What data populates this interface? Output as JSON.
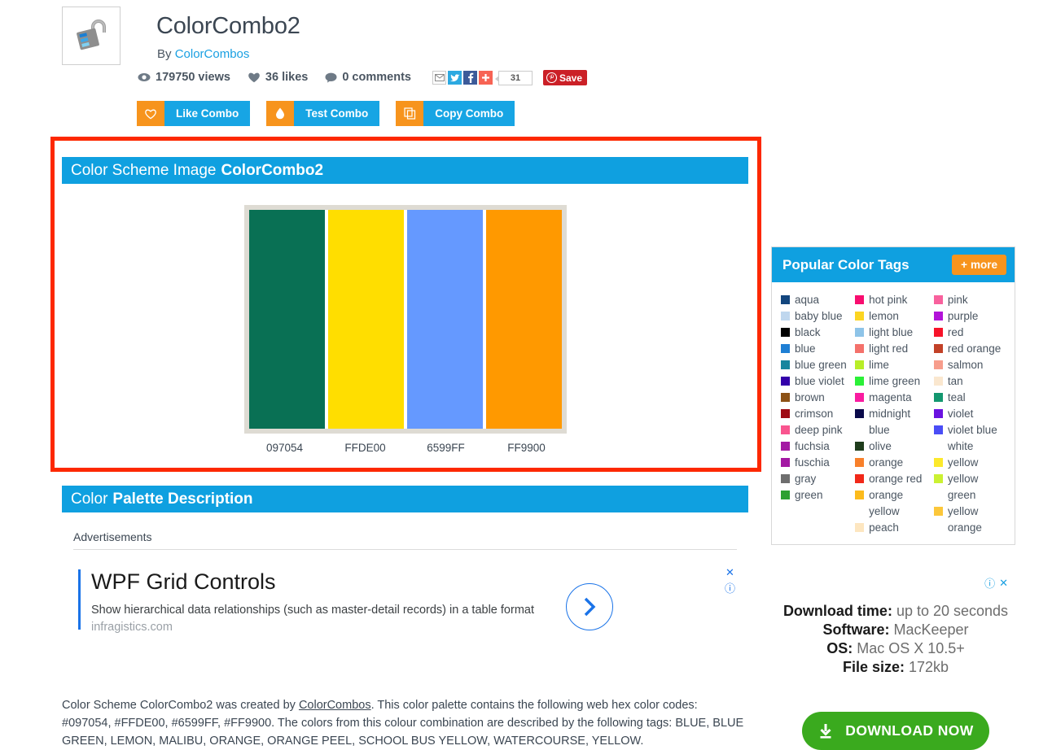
{
  "page": {
    "title": "ColorCombo2",
    "by_label": "By",
    "author": "ColorCombos"
  },
  "stats": {
    "views": "179750 views",
    "likes": "36 likes",
    "comments": "0 comments"
  },
  "share": {
    "count": "31",
    "pin_label": "Save"
  },
  "actions": [
    {
      "label": "Like Combo",
      "icon": "heart-icon"
    },
    {
      "label": "Test Combo",
      "icon": "droplet-icon"
    },
    {
      "label": "Copy Combo",
      "icon": "copy-icon"
    }
  ],
  "scheme_panel": {
    "head_plain": "Color Scheme Image",
    "head_bold": "ColorCombo2",
    "highlight_color": "#FD2800"
  },
  "chart_data": {
    "type": "bar",
    "title": "Color Scheme Image ColorCombo2",
    "categories": [
      "097054",
      "FFDE00",
      "6599FF",
      "FF9900"
    ],
    "values": [
      1,
      1,
      1,
      1
    ],
    "colors": [
      "#097054",
      "#FFDE00",
      "#6599FF",
      "#FF9900"
    ],
    "xlabel": "",
    "ylabel": "",
    "legend": "none",
    "grid": false
  },
  "description_panel": {
    "head_plain": "Color",
    "head_bold": "Palette Description",
    "advertisements_label": "Advertisements"
  },
  "ad": {
    "title": "WPF Grid Controls",
    "body": "Show hierarchical data relationships (such as master-detail records) in a table format",
    "domain": "infragistics.com",
    "close_icon": "close-icon",
    "info_icon": "info-icon",
    "arrow_icon": "chevron-right-icon"
  },
  "bottom_text": {
    "part1": "Color Scheme ColorCombo2 was created by ",
    "link": "ColorCombos",
    "part2": ". This color palette contains the following web hex color codes: #097054, #FFDE00, #6599FF, #FF9900. The colors from this colour combination are described by the following tags: BLUE, BLUE GREEN, LEMON, MALIBU, ORANGE, ORANGE PEEL, SCHOOL BUS YELLOW, WATERCOURSE, YELLOW."
  },
  "tags_panel": {
    "title": "Popular Color Tags",
    "more_label": "more",
    "columns": [
      [
        {
          "name": "aqua",
          "color": "#13467e"
        },
        {
          "name": "baby blue",
          "color": "#bfd7ee"
        },
        {
          "name": "black",
          "color": "#000000"
        },
        {
          "name": "blue",
          "color": "#1f7fd4"
        },
        {
          "name": "blue green",
          "color": "#17869e"
        },
        {
          "name": "blue violet",
          "color": "#3300aa"
        },
        {
          "name": "brown",
          "color": "#8c5115"
        },
        {
          "name": "crimson",
          "color": "#9e0b14"
        },
        {
          "name": "deep pink",
          "color": "#f9558f"
        },
        {
          "name": "fuchsia",
          "color": "#a319a3"
        },
        {
          "name": "fuschia",
          "color": "#a319a3"
        },
        {
          "name": "gray",
          "color": "#6e6e6e"
        },
        {
          "name": "green",
          "color": "#2da031"
        }
      ],
      [
        {
          "name": "hot pink",
          "color": "#f80d6f"
        },
        {
          "name": "lemon",
          "color": "#fcd522"
        },
        {
          "name": "light blue",
          "color": "#8ec4e8"
        },
        {
          "name": "light red",
          "color": "#f4716b"
        },
        {
          "name": "lime",
          "color": "#b8ee28"
        },
        {
          "name": "lime green",
          "color": "#2bf038"
        },
        {
          "name": "magenta",
          "color": "#f91ba0"
        },
        {
          "name": "midnight blue",
          "color": "#0a0a4a"
        },
        {
          "name": "olive",
          "color": "#1f3c1c"
        },
        {
          "name": "orange",
          "color": "#f8802a"
        },
        {
          "name": "orange red",
          "color": "#f12819"
        },
        {
          "name": "orange yellow",
          "color": "#fcbb1c"
        },
        {
          "name": "peach",
          "color": "#fde6c0"
        }
      ],
      [
        {
          "name": "pink",
          "color": "#f8619d"
        },
        {
          "name": "purple",
          "color": "#b213d9"
        },
        {
          "name": "red",
          "color": "#f71329"
        },
        {
          "name": "red orange",
          "color": "#c24127"
        },
        {
          "name": "salmon",
          "color": "#f79d8c"
        },
        {
          "name": "tan",
          "color": "#fae7cf"
        },
        {
          "name": "teal",
          "color": "#13976f"
        },
        {
          "name": "violet",
          "color": "#6a12e0"
        },
        {
          "name": "violet blue",
          "color": "#4a4df6"
        },
        {
          "name": "white",
          "color": ""
        },
        {
          "name": "yellow",
          "color": "#fce92c"
        },
        {
          "name": "yellow green",
          "color": "#cbf132"
        },
        {
          "name": "yellow orange",
          "color": "#fcc73a"
        }
      ]
    ]
  },
  "download_ad": {
    "rows": [
      {
        "label": "Download time:",
        "value": "up to 20 seconds"
      },
      {
        "label": "Software:",
        "value": "MacKeeper"
      },
      {
        "label": "OS:",
        "value": "Mac OS X 10.5+"
      },
      {
        "label": "File size:",
        "value": "172kb"
      }
    ],
    "button_label": "DOWNLOAD NOW",
    "info_icon": "info-icon",
    "close_icon": "close-icon"
  }
}
